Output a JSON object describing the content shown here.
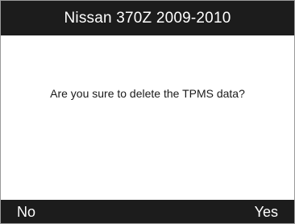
{
  "header": {
    "title": "Nissan 370Z 2009-2010"
  },
  "dialog": {
    "message": "Are you sure to delete the TPMS data?"
  },
  "softkeys": {
    "left_label": "No",
    "right_label": "Yes"
  },
  "colors": {
    "bar_background": "#1c1c1c",
    "bar_text": "#ffffff",
    "screen_background": "#ffffff",
    "message_text": "#1a1a1a"
  }
}
